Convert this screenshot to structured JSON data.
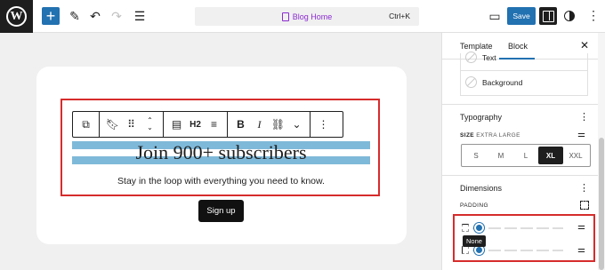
{
  "topbar": {
    "logo_letter": "W",
    "command_bar": {
      "title": "Blog Home",
      "shortcut": "Ctrl+K"
    },
    "save_label": "Save",
    "plus_glyph": "+",
    "more_glyph": "⋮"
  },
  "canvas": {
    "heading": "Join 900+ subscribers",
    "subtext": "Stay in the loop with everything you need to know.",
    "signup_label": "Sign up",
    "toolbar": {
      "h2_label": "H2",
      "bold_label": "B",
      "italic_label": "I"
    }
  },
  "sidebar": {
    "tabs": [
      {
        "label": "Template"
      },
      {
        "label": "Block"
      }
    ],
    "active_tab": "Block",
    "close_glyph": "✕",
    "color_items": [
      {
        "label": "Text"
      },
      {
        "label": "Background"
      }
    ],
    "typography": {
      "title": "Typography",
      "size_label": "SIZE",
      "size_value": "EXTRA LARGE",
      "options": [
        "S",
        "M",
        "L",
        "XL",
        "XXL"
      ],
      "selected": "XL"
    },
    "dimensions": {
      "title": "Dimensions",
      "padding_label": "PADDING"
    },
    "tooltip": "None"
  },
  "colors": {
    "accent": "#2271b1",
    "highlight": "#d62c2c",
    "heading_band": "#7fb9d9",
    "command_title": "#8b2bd1"
  }
}
